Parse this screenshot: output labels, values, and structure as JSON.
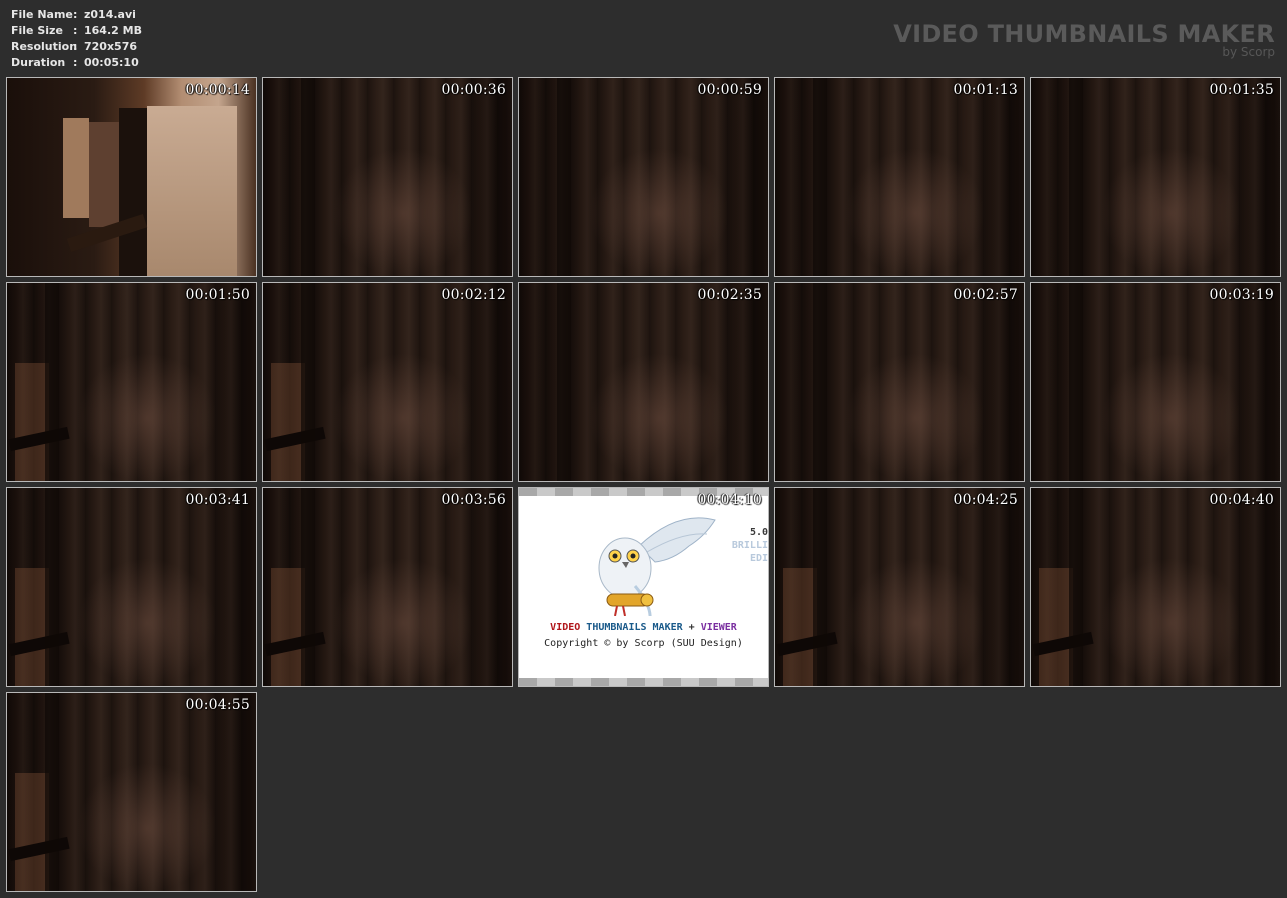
{
  "file_info": [
    {
      "key": "File Name",
      "value": "z014.avi"
    },
    {
      "key": "File Size",
      "value": "164.2 MB"
    },
    {
      "key": "Resolution",
      "value": "720x576"
    },
    {
      "key": "Duration",
      "value": "00:05:10"
    }
  ],
  "separator": ":",
  "brand": {
    "title": "VIDEO THUMBNAILS MAKER",
    "subtitle": "by Scorp"
  },
  "thumbnails": [
    {
      "timestamp": "00:00:14"
    },
    {
      "timestamp": "00:00:36"
    },
    {
      "timestamp": "00:00:59"
    },
    {
      "timestamp": "00:01:13"
    },
    {
      "timestamp": "00:01:35"
    },
    {
      "timestamp": "00:01:50"
    },
    {
      "timestamp": "00:02:12"
    },
    {
      "timestamp": "00:02:35"
    },
    {
      "timestamp": "00:02:57"
    },
    {
      "timestamp": "00:03:19"
    },
    {
      "timestamp": "00:03:41"
    },
    {
      "timestamp": "00:03:56"
    },
    {
      "timestamp": "00:04:10"
    },
    {
      "timestamp": "00:04:25"
    },
    {
      "timestamp": "00:04:40"
    },
    {
      "timestamp": "00:04:55"
    }
  ],
  "logo_frame": {
    "version": "5.0",
    "edition_line1": "BRILLI",
    "edition_line2": "EDI",
    "product_parts": [
      {
        "text": "VIDEO ",
        "color": "#b0161a"
      },
      {
        "text": "THUMBNAILS MAKER",
        "color": "#1a5a8a"
      },
      {
        "text": " + ",
        "color": "#333333"
      },
      {
        "text": "VIEWER",
        "color": "#7a2fa0"
      }
    ],
    "copyright": "Copyright © by Scorp (SUU Design)"
  },
  "colors": {
    "background": "#2d2d2d",
    "thumb_border": "#b8b8b8",
    "header_text": "#e6e6e6",
    "brand_text": "#5a5a5a"
  }
}
